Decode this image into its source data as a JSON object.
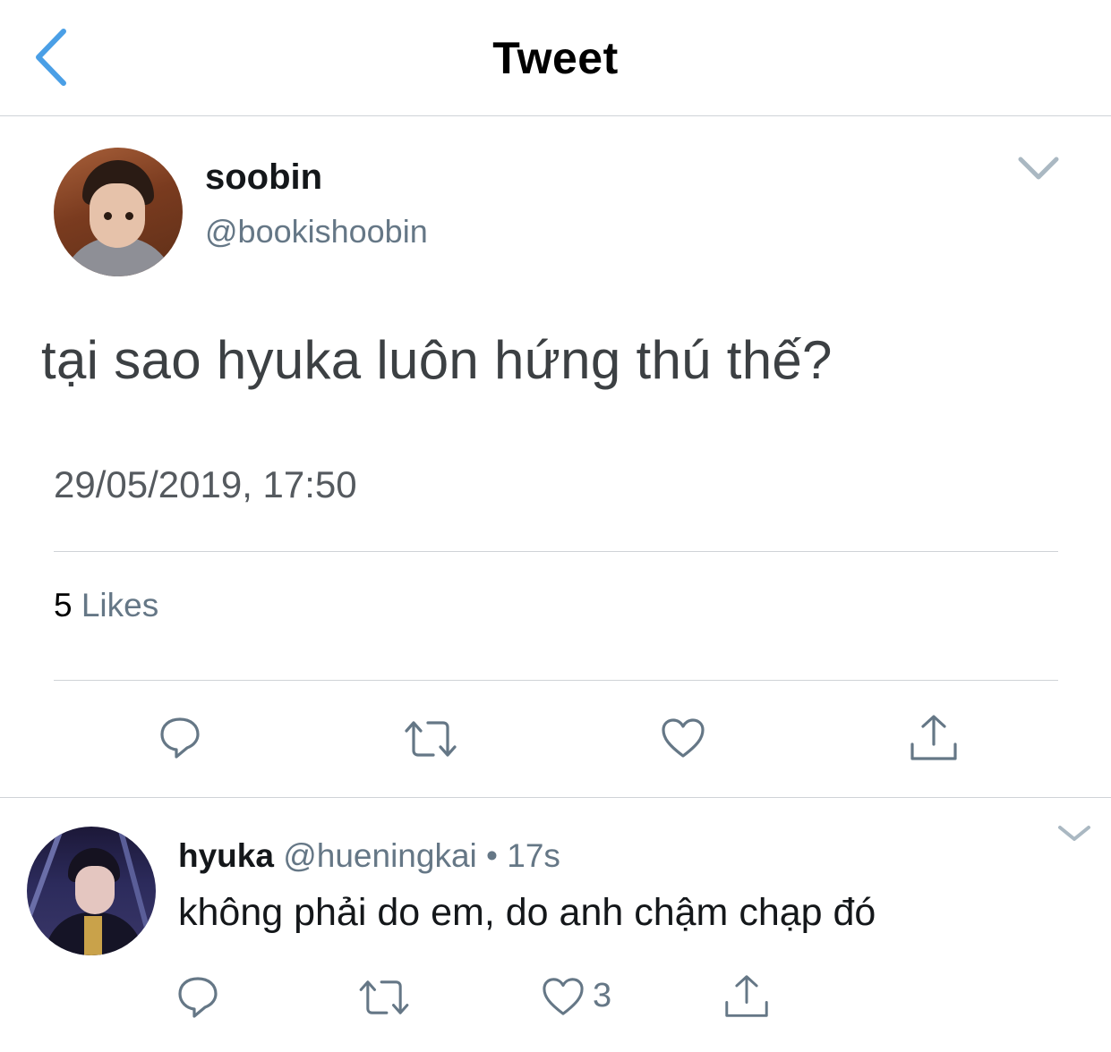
{
  "header": {
    "title": "Tweet"
  },
  "tweet": {
    "author_name": "soobin",
    "author_handle": "@bookishoobin",
    "text": "tại sao hyuka luôn hứng thú thế?",
    "timestamp": "29/05/2019, 17:50",
    "likes_count": "5",
    "likes_label": " Likes"
  },
  "reply": {
    "author_name": "hyuka",
    "meta": " @hueningkai • 17s",
    "text": "không phải do em, do anh chậm chạp đó",
    "like_count": "3"
  },
  "colors": {
    "accent": "#1da1f2",
    "back_arrow": "#4a9fe6",
    "icon_gray": "#657786",
    "divider": "#cfd3d7"
  },
  "icons": {
    "back": "chevron-left-icon",
    "more": "chevron-down-icon",
    "reply": "reply-icon",
    "retweet": "retweet-icon",
    "like": "heart-icon",
    "share": "share-icon"
  }
}
